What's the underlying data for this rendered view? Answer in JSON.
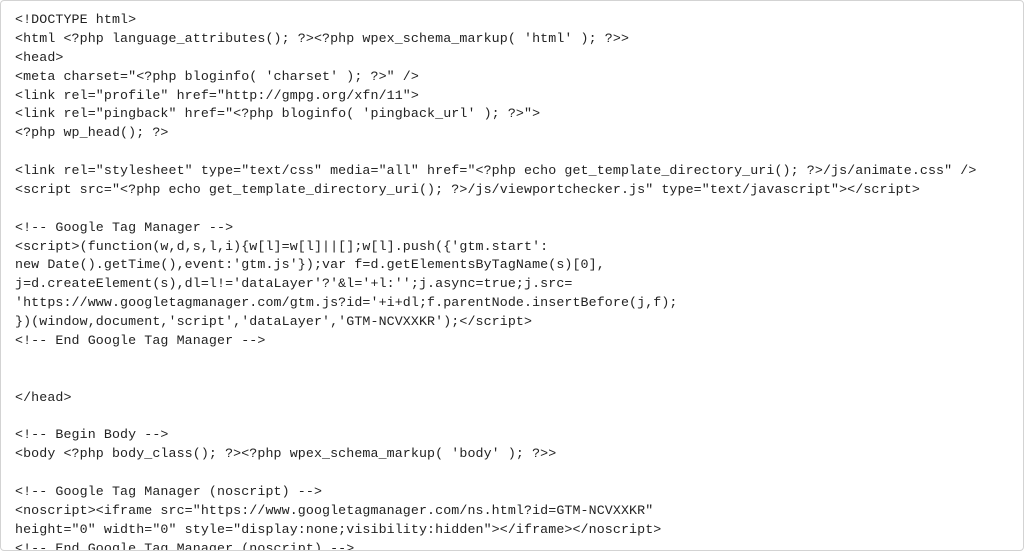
{
  "code": {
    "lines": [
      "<!DOCTYPE html>",
      "<html <?php language_attributes(); ?><?php wpex_schema_markup( 'html' ); ?>>",
      "<head>",
      "<meta charset=\"<?php bloginfo( 'charset' ); ?>\" />",
      "<link rel=\"profile\" href=\"http://gmpg.org/xfn/11\">",
      "<link rel=\"pingback\" href=\"<?php bloginfo( 'pingback_url' ); ?>\">",
      "<?php wp_head(); ?>",
      "",
      "<link rel=\"stylesheet\" type=\"text/css\" media=\"all\" href=\"<?php echo get_template_directory_uri(); ?>/js/animate.css\" />",
      "<script src=\"<?php echo get_template_directory_uri(); ?>/js/viewportchecker.js\" type=\"text/javascript\"></script>",
      "",
      "<!-- Google Tag Manager -->",
      "<script>(function(w,d,s,l,i){w[l]=w[l]||[];w[l].push({'gtm.start':",
      "new Date().getTime(),event:'gtm.js'});var f=d.getElementsByTagName(s)[0],",
      "j=d.createElement(s),dl=l!='dataLayer'?'&l='+l:'';j.async=true;j.src=",
      "'https://www.googletagmanager.com/gtm.js?id='+i+dl;f.parentNode.insertBefore(j,f);",
      "})(window,document,'script','dataLayer','GTM-NCVXXKR');</script>",
      "<!-- End Google Tag Manager -->",
      "",
      "",
      "</head>",
      "",
      "<!-- Begin Body -->",
      "<body <?php body_class(); ?><?php wpex_schema_markup( 'body' ); ?>>",
      "",
      "<!-- Google Tag Manager (noscript) -->",
      "<noscript><iframe src=\"https://www.googletagmanager.com/ns.html?id=GTM-NCVXXKR\"",
      "height=\"0\" width=\"0\" style=\"display:none;visibility:hidden\"></iframe></noscript>",
      "<!-- End Google Tag Manager (noscript) -->"
    ]
  }
}
